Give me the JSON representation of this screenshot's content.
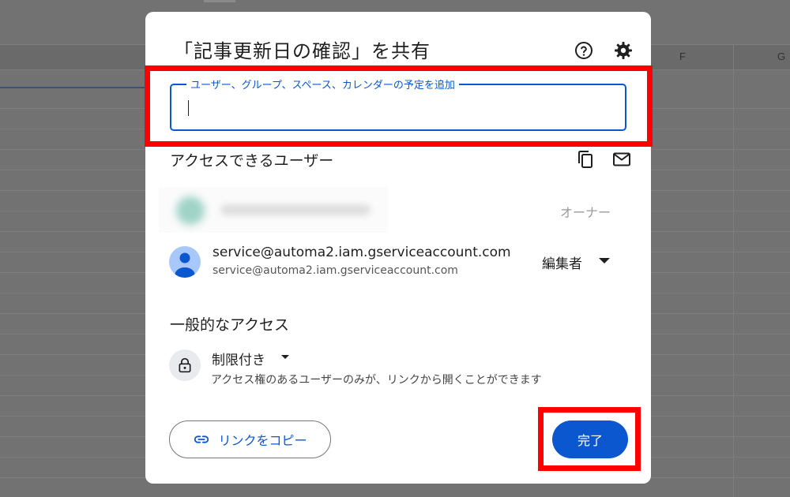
{
  "sheet": {
    "col_f": "F",
    "col_g": "G"
  },
  "dialog": {
    "title": "「記事更新日の確認」を共有",
    "input": {
      "label": "ユーザー、グループ、スペース、カレンダーの予定を追加",
      "value": ""
    },
    "access_section": {
      "title": "アクセスできるユーザー",
      "owner_role": "オーナー",
      "users": [
        {
          "name": "service@automa2.iam.gserviceaccount.com",
          "email": "service@automa2.iam.gserviceaccount.com",
          "role": "編集者"
        }
      ]
    },
    "general_access": {
      "title": "一般的なアクセス",
      "setting": "制限付き",
      "description": "アクセス権のあるユーザーのみが、リンクから開くことができます"
    },
    "buttons": {
      "copy_link": "リンクをコピー",
      "done": "完了"
    }
  },
  "highlight_color": "#ff0000",
  "accent_color": "#0b57d0"
}
